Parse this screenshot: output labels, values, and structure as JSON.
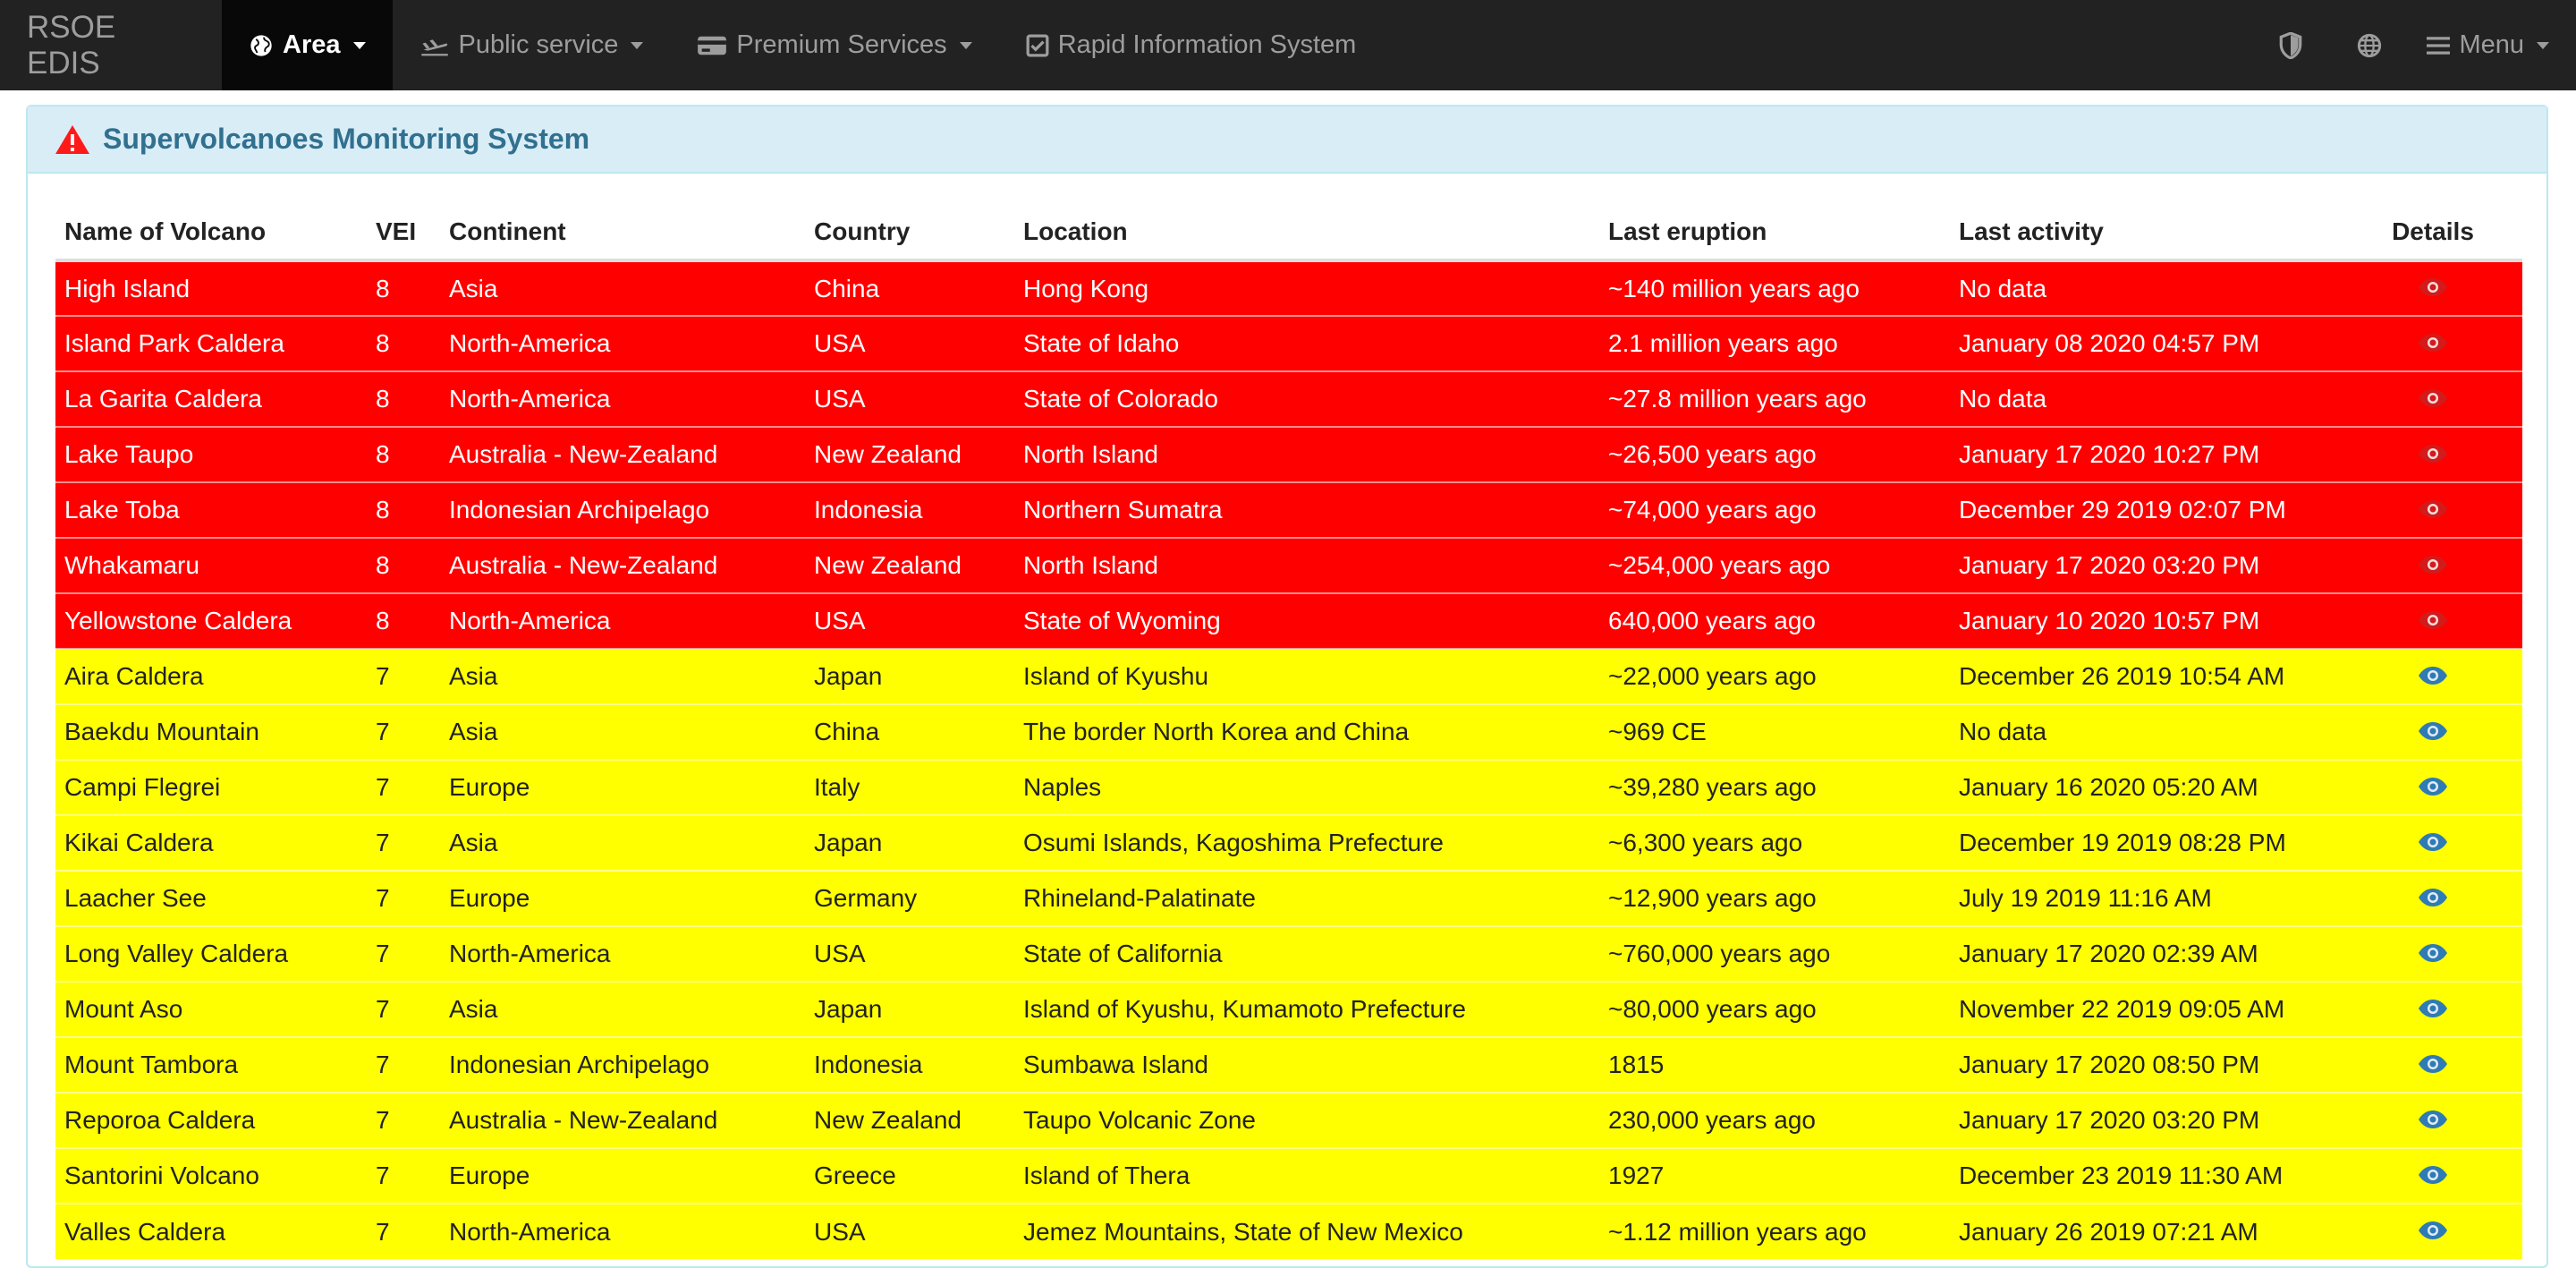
{
  "navbar": {
    "brand": "RSOE EDIS",
    "items": [
      {
        "label": "Area",
        "icon": "globe-icon",
        "active": true
      },
      {
        "label": "Public service",
        "icon": "plane-icon",
        "active": false
      },
      {
        "label": "Premium Services",
        "icon": "credit-card-icon",
        "active": false
      },
      {
        "label": "Rapid Information System",
        "icon": "checkbox-icon",
        "active": false
      }
    ],
    "right": {
      "shield_icon": "shield-icon",
      "globe_icon": "globe-icon",
      "menu_label": "Menu"
    }
  },
  "panel": {
    "icon": "warning-triangle-icon",
    "title": "Supervolcanoes Monitoring System"
  },
  "table": {
    "headers": [
      "Name of Volcano",
      "VEI",
      "Continent",
      "Country",
      "Location",
      "Last eruption",
      "Last activity",
      "Details"
    ],
    "rows": [
      {
        "name": "High Island",
        "vei": "8",
        "continent": "Asia",
        "country": "China",
        "location": "Hong Kong",
        "last_eruption": "~140 million years ago",
        "last_activity": "No data"
      },
      {
        "name": "Island Park Caldera",
        "vei": "8",
        "continent": "North-America",
        "country": "USA",
        "location": "State of Idaho",
        "last_eruption": "2.1 million years ago",
        "last_activity": "January 08 2020 04:57 PM"
      },
      {
        "name": "La Garita Caldera",
        "vei": "8",
        "continent": "North-America",
        "country": "USA",
        "location": "State of Colorado",
        "last_eruption": "~27.8 million years ago",
        "last_activity": "No data"
      },
      {
        "name": "Lake Taupo",
        "vei": "8",
        "continent": "Australia - New-Zealand",
        "country": "New Zealand",
        "location": "North Island",
        "last_eruption": "~26,500 years ago",
        "last_activity": "January 17 2020 10:27 PM"
      },
      {
        "name": "Lake Toba",
        "vei": "8",
        "continent": "Indonesian Archipelago",
        "country": "Indonesia",
        "location": "Northern Sumatra",
        "last_eruption": "~74,000 years ago",
        "last_activity": "December 29 2019 02:07 PM"
      },
      {
        "name": "Whakamaru",
        "vei": "8",
        "continent": "Australia - New-Zealand",
        "country": "New Zealand",
        "location": "North Island",
        "last_eruption": "~254,000 years ago",
        "last_activity": "January 17 2020 03:20 PM"
      },
      {
        "name": "Yellowstone Caldera",
        "vei": "8",
        "continent": "North-America",
        "country": "USA",
        "location": "State of Wyoming",
        "last_eruption": "640,000 years ago",
        "last_activity": "January 10 2020 10:57 PM"
      },
      {
        "name": "Aira Caldera",
        "vei": "7",
        "continent": "Asia",
        "country": "Japan",
        "location": "Island of Kyushu",
        "last_eruption": "~22,000 years ago",
        "last_activity": "December 26 2019 10:54 AM"
      },
      {
        "name": "Baekdu Mountain",
        "vei": "7",
        "continent": "Asia",
        "country": "China",
        "location": "The border North Korea and China",
        "last_eruption": "~969 CE",
        "last_activity": "No data"
      },
      {
        "name": "Campi Flegrei",
        "vei": "7",
        "continent": "Europe",
        "country": "Italy",
        "location": "Naples",
        "last_eruption": "~39,280 years ago",
        "last_activity": "January 16 2020 05:20 AM"
      },
      {
        "name": "Kikai Caldera",
        "vei": "7",
        "continent": "Asia",
        "country": "Japan",
        "location": "Osumi Islands, Kagoshima Prefecture",
        "last_eruption": "~6,300 years ago",
        "last_activity": "December 19 2019 08:28 PM"
      },
      {
        "name": "Laacher See",
        "vei": "7",
        "continent": "Europe",
        "country": "Germany",
        "location": "Rhineland-Palatinate",
        "last_eruption": "~12,900 years ago",
        "last_activity": "July 19 2019 11:16 AM"
      },
      {
        "name": "Long Valley Caldera",
        "vei": "7",
        "continent": "North-America",
        "country": "USA",
        "location": "State of California",
        "last_eruption": "~760,000 years ago",
        "last_activity": "January 17 2020 02:39 AM"
      },
      {
        "name": "Mount Aso",
        "vei": "7",
        "continent": "Asia",
        "country": "Japan",
        "location": "Island of Kyushu, Kumamoto Prefecture",
        "last_eruption": "~80,000 years ago",
        "last_activity": "November 22 2019 09:05 AM"
      },
      {
        "name": "Mount Tambora",
        "vei": "7",
        "continent": "Indonesian Archipelago",
        "country": "Indonesia",
        "location": "Sumbawa Island",
        "last_eruption": "1815",
        "last_activity": "January 17 2020 08:50 PM"
      },
      {
        "name": "Reporoa Caldera",
        "vei": "7",
        "continent": "Australia - New-Zealand",
        "country": "New Zealand",
        "location": "Taupo Volcanic Zone",
        "last_eruption": "230,000 years ago",
        "last_activity": "January 17 2020 03:20 PM"
      },
      {
        "name": "Santorini Volcano",
        "vei": "7",
        "continent": "Europe",
        "country": "Greece",
        "location": "Island of Thera",
        "last_eruption": "1927",
        "last_activity": "December 23 2019 11:30 AM"
      },
      {
        "name": "Valles Caldera",
        "vei": "7",
        "continent": "North-America",
        "country": "USA",
        "location": "Jemez Mountains, State of New Mexico",
        "last_eruption": "~1.12 million years ago",
        "last_activity": "January 26 2019 07:21 AM"
      }
    ]
  },
  "colors": {
    "vei8_row": "#ff0000",
    "vei7_row": "#ffff00",
    "navbar_bg": "#222222",
    "panel_heading_bg": "#d9edf7",
    "panel_title": "#31708f"
  }
}
